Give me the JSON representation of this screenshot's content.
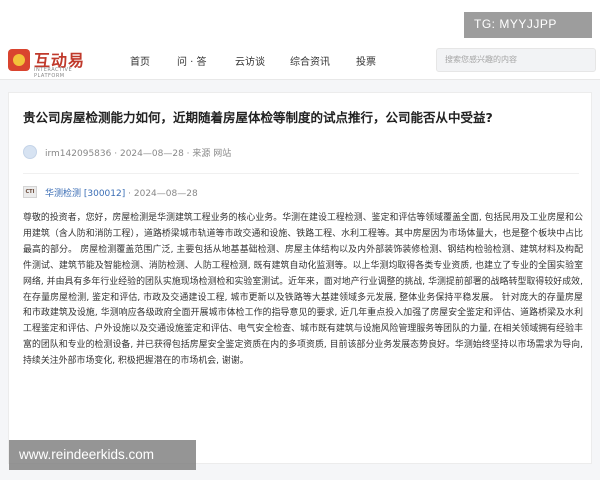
{
  "watermarks": {
    "top_right": "TG: MYYJJPP",
    "bottom_left": "www.reindeerkids.com"
  },
  "header": {
    "logo_text": "互动易",
    "logo_subtext": "INTERACTIVE PLATFORM",
    "nav": [
      {
        "label": "首页"
      },
      {
        "label": "问 · 答"
      },
      {
        "label": "云访谈"
      },
      {
        "label": "综合资讯"
      },
      {
        "label": "投票"
      }
    ],
    "search_placeholder": "搜索您感兴趣的内容"
  },
  "question": {
    "title": "贵公司房屋检测能力如何，近期随着房屋体检等制度的试点推行，公司能否从中受益?",
    "asker": "irm142095836",
    "date": "2024—08—28",
    "source": "来源 网站",
    "meta_separator": "·"
  },
  "answer": {
    "company": "华测检测 [300012]",
    "date": "2024—08—28",
    "company_logo": "CTI",
    "text": "尊敬的投资者，您好，房屋检测是华测建筑工程业务的核心业务。华测在建设工程检测、鉴定和评估等领域覆盖全面, 包括民用及工业房屋和公用建筑（含人防和消防工程），道路桥梁城市轨道等市政交通和设施、铁路工程、水利工程等。其中房屋因为市场体量大，也是整个板块中占比最高的部分。 房屋检测覆盖范围广泛, 主要包括从地基基础检测、房屋主体结构以及内外部装饰装修检测、钢结构检验检测、建筑材料及构配件测试、建筑节能及智能检测、消防检测、人防工程检测, 既有建筑自动化监测等。以上华测均取得各类专业资质, 也建立了专业的全国实验室网络, 并由具有多年行业经验的团队实施现场检测检和实验室测试。近年来，面对地产行业调整的挑战, 华测提前部署的战略转型取得较好成效, 在存量房屋检测, 鉴定和评估, 市政及交通建设工程, 城市更新以及铁路等大基建领域多元发展, 整体业务保持平稳发展。 针对庞大的存量房屋和市政建筑及设施, 华测响应各级政府全面开展城市体检工作的指导意见的要求, 近几年重点投入加强了房屋安全鉴定和评估、道路桥梁及水利工程鉴定和评估、户外设施以及交通设施鉴定和评估、电气安全检查、城市既有建筑与设施风险管理服务等团队的力量, 在相关领域拥有经验丰富的团队和专业的检测设备, 并已获得包括房屋安全鉴定资质在内的多项资质, 目前该部分业务发展态势良好。华测始终坚持以市场需求为导向, 持续关注外部市场变化, 积极把握潜在的市场机会, 谢谢。"
  },
  "colors": {
    "accent_link": "#3a6db5",
    "logo_red": "#d9442f",
    "logo_yellow": "#f3c23a"
  }
}
